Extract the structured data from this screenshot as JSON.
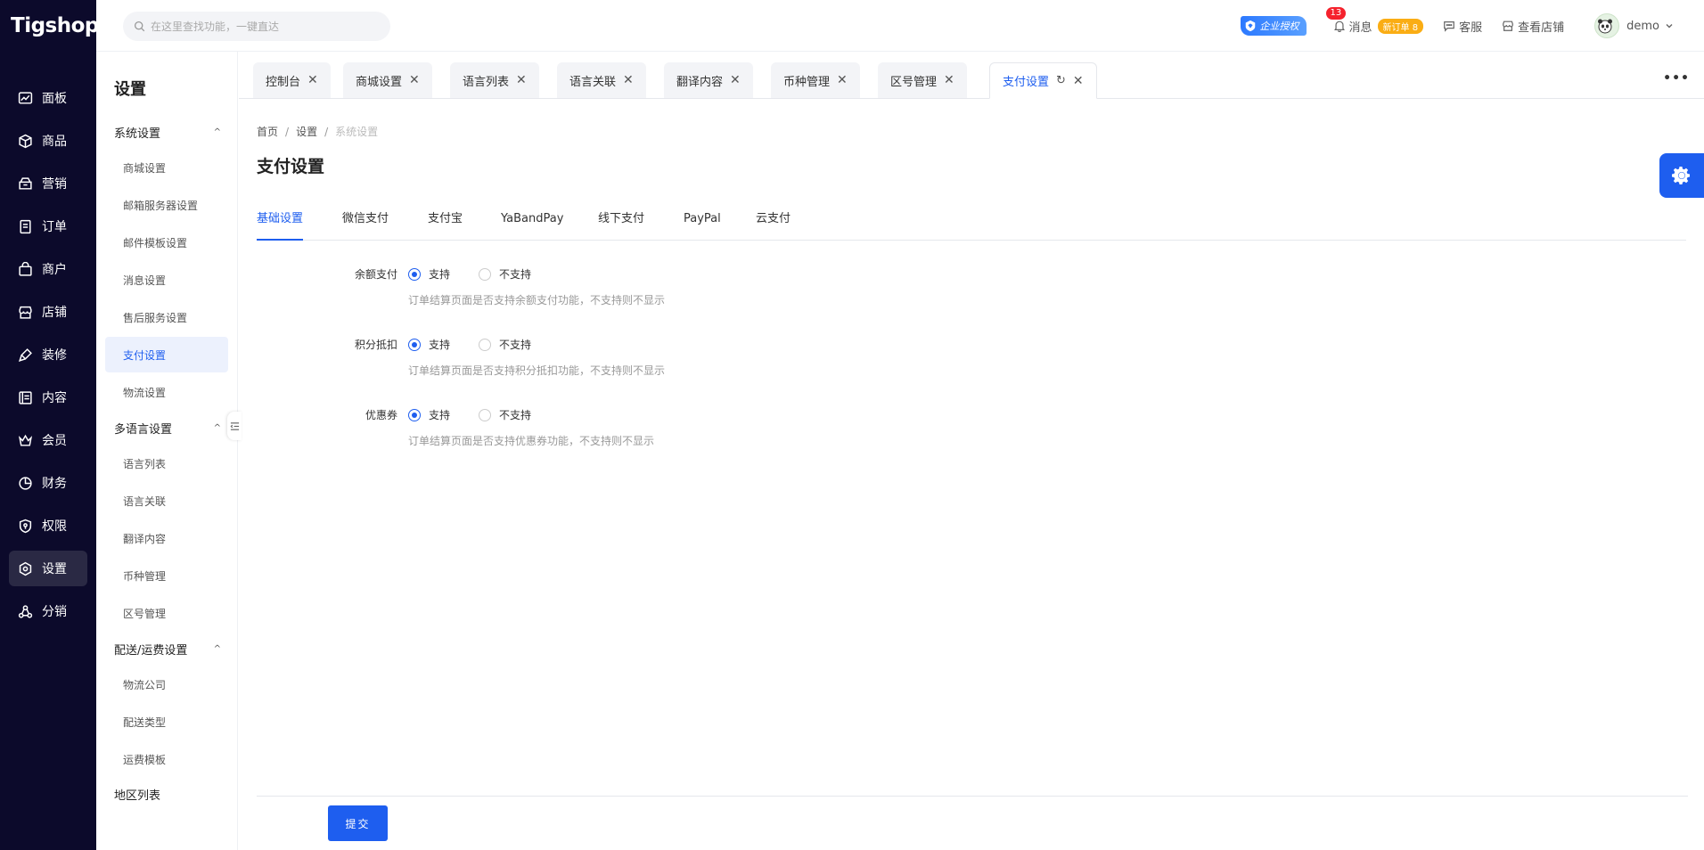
{
  "app": {
    "logo": "Tigshop"
  },
  "search": {
    "placeholder": "在这里查找功能，一键直达"
  },
  "header": {
    "enterprise_badge": "企业授权",
    "message_label": "消息",
    "message_count": "13",
    "new_order_badge": "新订单 8",
    "service_label": "客服",
    "view_store_label": "查看店铺",
    "user_name": "demo"
  },
  "nav": {
    "items": [
      {
        "label": "面板",
        "icon": "dashboard-icon"
      },
      {
        "label": "商品",
        "icon": "box-icon"
      },
      {
        "label": "营销",
        "icon": "marketing-icon"
      },
      {
        "label": "订单",
        "icon": "order-icon"
      },
      {
        "label": "商户",
        "icon": "merchant-icon"
      },
      {
        "label": "店铺",
        "icon": "store-icon"
      },
      {
        "label": "装修",
        "icon": "decorate-icon"
      },
      {
        "label": "内容",
        "icon": "content-icon"
      },
      {
        "label": "会员",
        "icon": "member-icon"
      },
      {
        "label": "财务",
        "icon": "finance-icon"
      },
      {
        "label": "权限",
        "icon": "permission-icon"
      },
      {
        "label": "设置",
        "icon": "settings-icon",
        "active": true
      },
      {
        "label": "分销",
        "icon": "distribution-icon"
      }
    ]
  },
  "subnav": {
    "title": "设置",
    "group1": {
      "label": "系统设置",
      "items": [
        "商城设置",
        "邮箱服务器设置",
        "邮件模板设置",
        "消息设置",
        "售后服务设置",
        "支付设置",
        "物流设置"
      ]
    },
    "group2": {
      "label": "多语言设置",
      "items": [
        "语言列表",
        "语言关联",
        "翻译内容",
        "币种管理",
        "区号管理"
      ]
    },
    "group3": {
      "label": "配送/运费设置",
      "items": [
        "物流公司",
        "配送类型",
        "运费模板"
      ]
    },
    "group4": {
      "label": "地区列表"
    }
  },
  "page_tabs": [
    {
      "label": "控制台"
    },
    {
      "label": "商城设置"
    },
    {
      "label": "语言列表"
    },
    {
      "label": "语言关联"
    },
    {
      "label": "翻译内容"
    },
    {
      "label": "币种管理"
    },
    {
      "label": "区号管理"
    },
    {
      "label": "支付设置",
      "active": true
    }
  ],
  "breadcrumb": {
    "home": "首页",
    "level1": "设置",
    "current": "系统设置"
  },
  "page_title": "支付设置",
  "content_tabs": [
    "基础设置",
    "微信支付",
    "支付宝",
    "YaBandPay",
    "线下支付",
    "PayPal",
    "云支付"
  ],
  "form": {
    "rows": [
      {
        "label": "余额支付",
        "opt_yes": "支持",
        "opt_no": "不支持",
        "selected": "支持",
        "hint": "订单结算页面是否支持余额支付功能，不支持则不显示"
      },
      {
        "label": "积分抵扣",
        "opt_yes": "支持",
        "opt_no": "不支持",
        "selected": "支持",
        "hint": "订单结算页面是否支持积分抵扣功能，不支持则不显示"
      },
      {
        "label": "优惠券",
        "opt_yes": "支持",
        "opt_no": "不支持",
        "selected": "支持",
        "hint": "订单结算页面是否支持优惠券功能，不支持则不显示"
      }
    ],
    "submit_label": "提交"
  },
  "colors": {
    "primary": "#1e5eef",
    "sidebar_bg": "#0c0a2b",
    "badge_orange": "#faad14",
    "badge_red": "#f5222d"
  }
}
